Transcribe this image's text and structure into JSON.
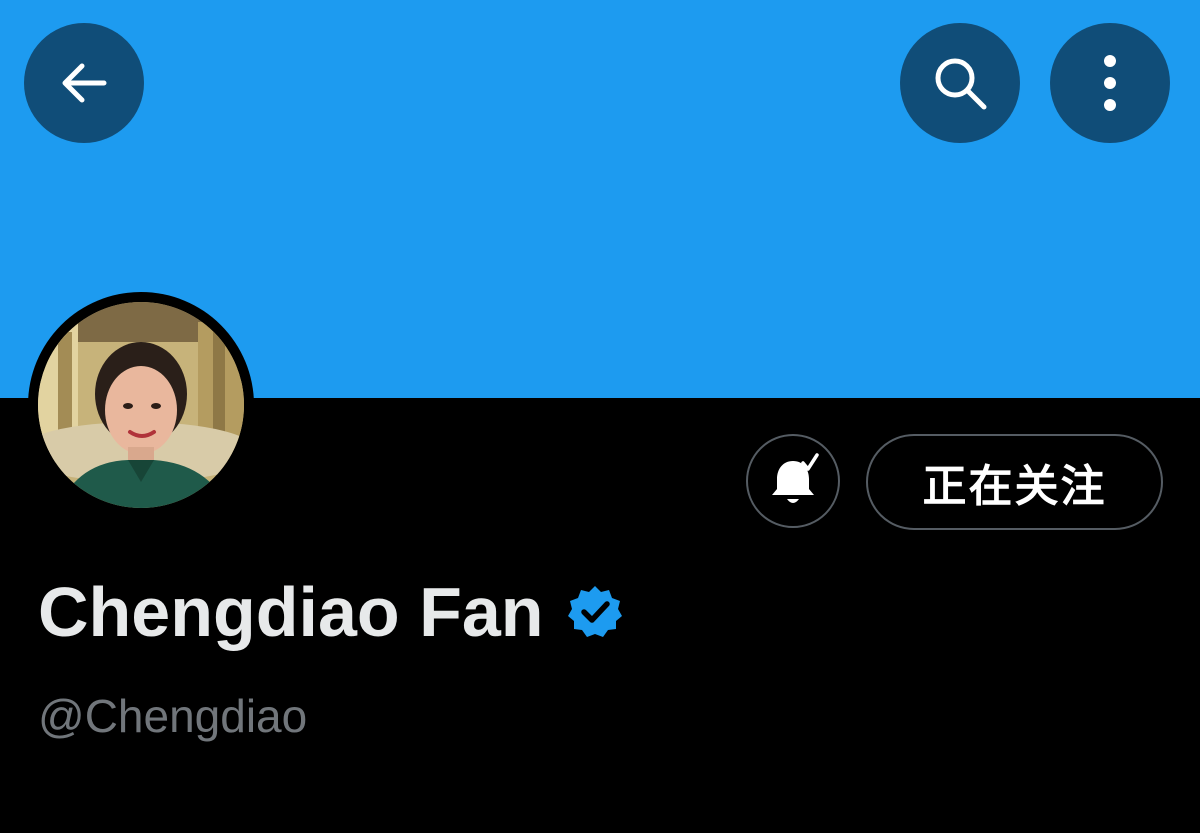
{
  "header": {
    "banner_color": "#1d9bf0",
    "back_icon": "arrow-left-icon",
    "search_icon": "search-icon",
    "more_icon": "more-vertical-icon"
  },
  "profile": {
    "display_name": "Chengdiao Fan",
    "handle": "@Chengdiao",
    "verified": true,
    "verified_color": "#1d9bf0",
    "follow_button_label": "正在关注",
    "notification_icon": "bell-check-icon"
  }
}
